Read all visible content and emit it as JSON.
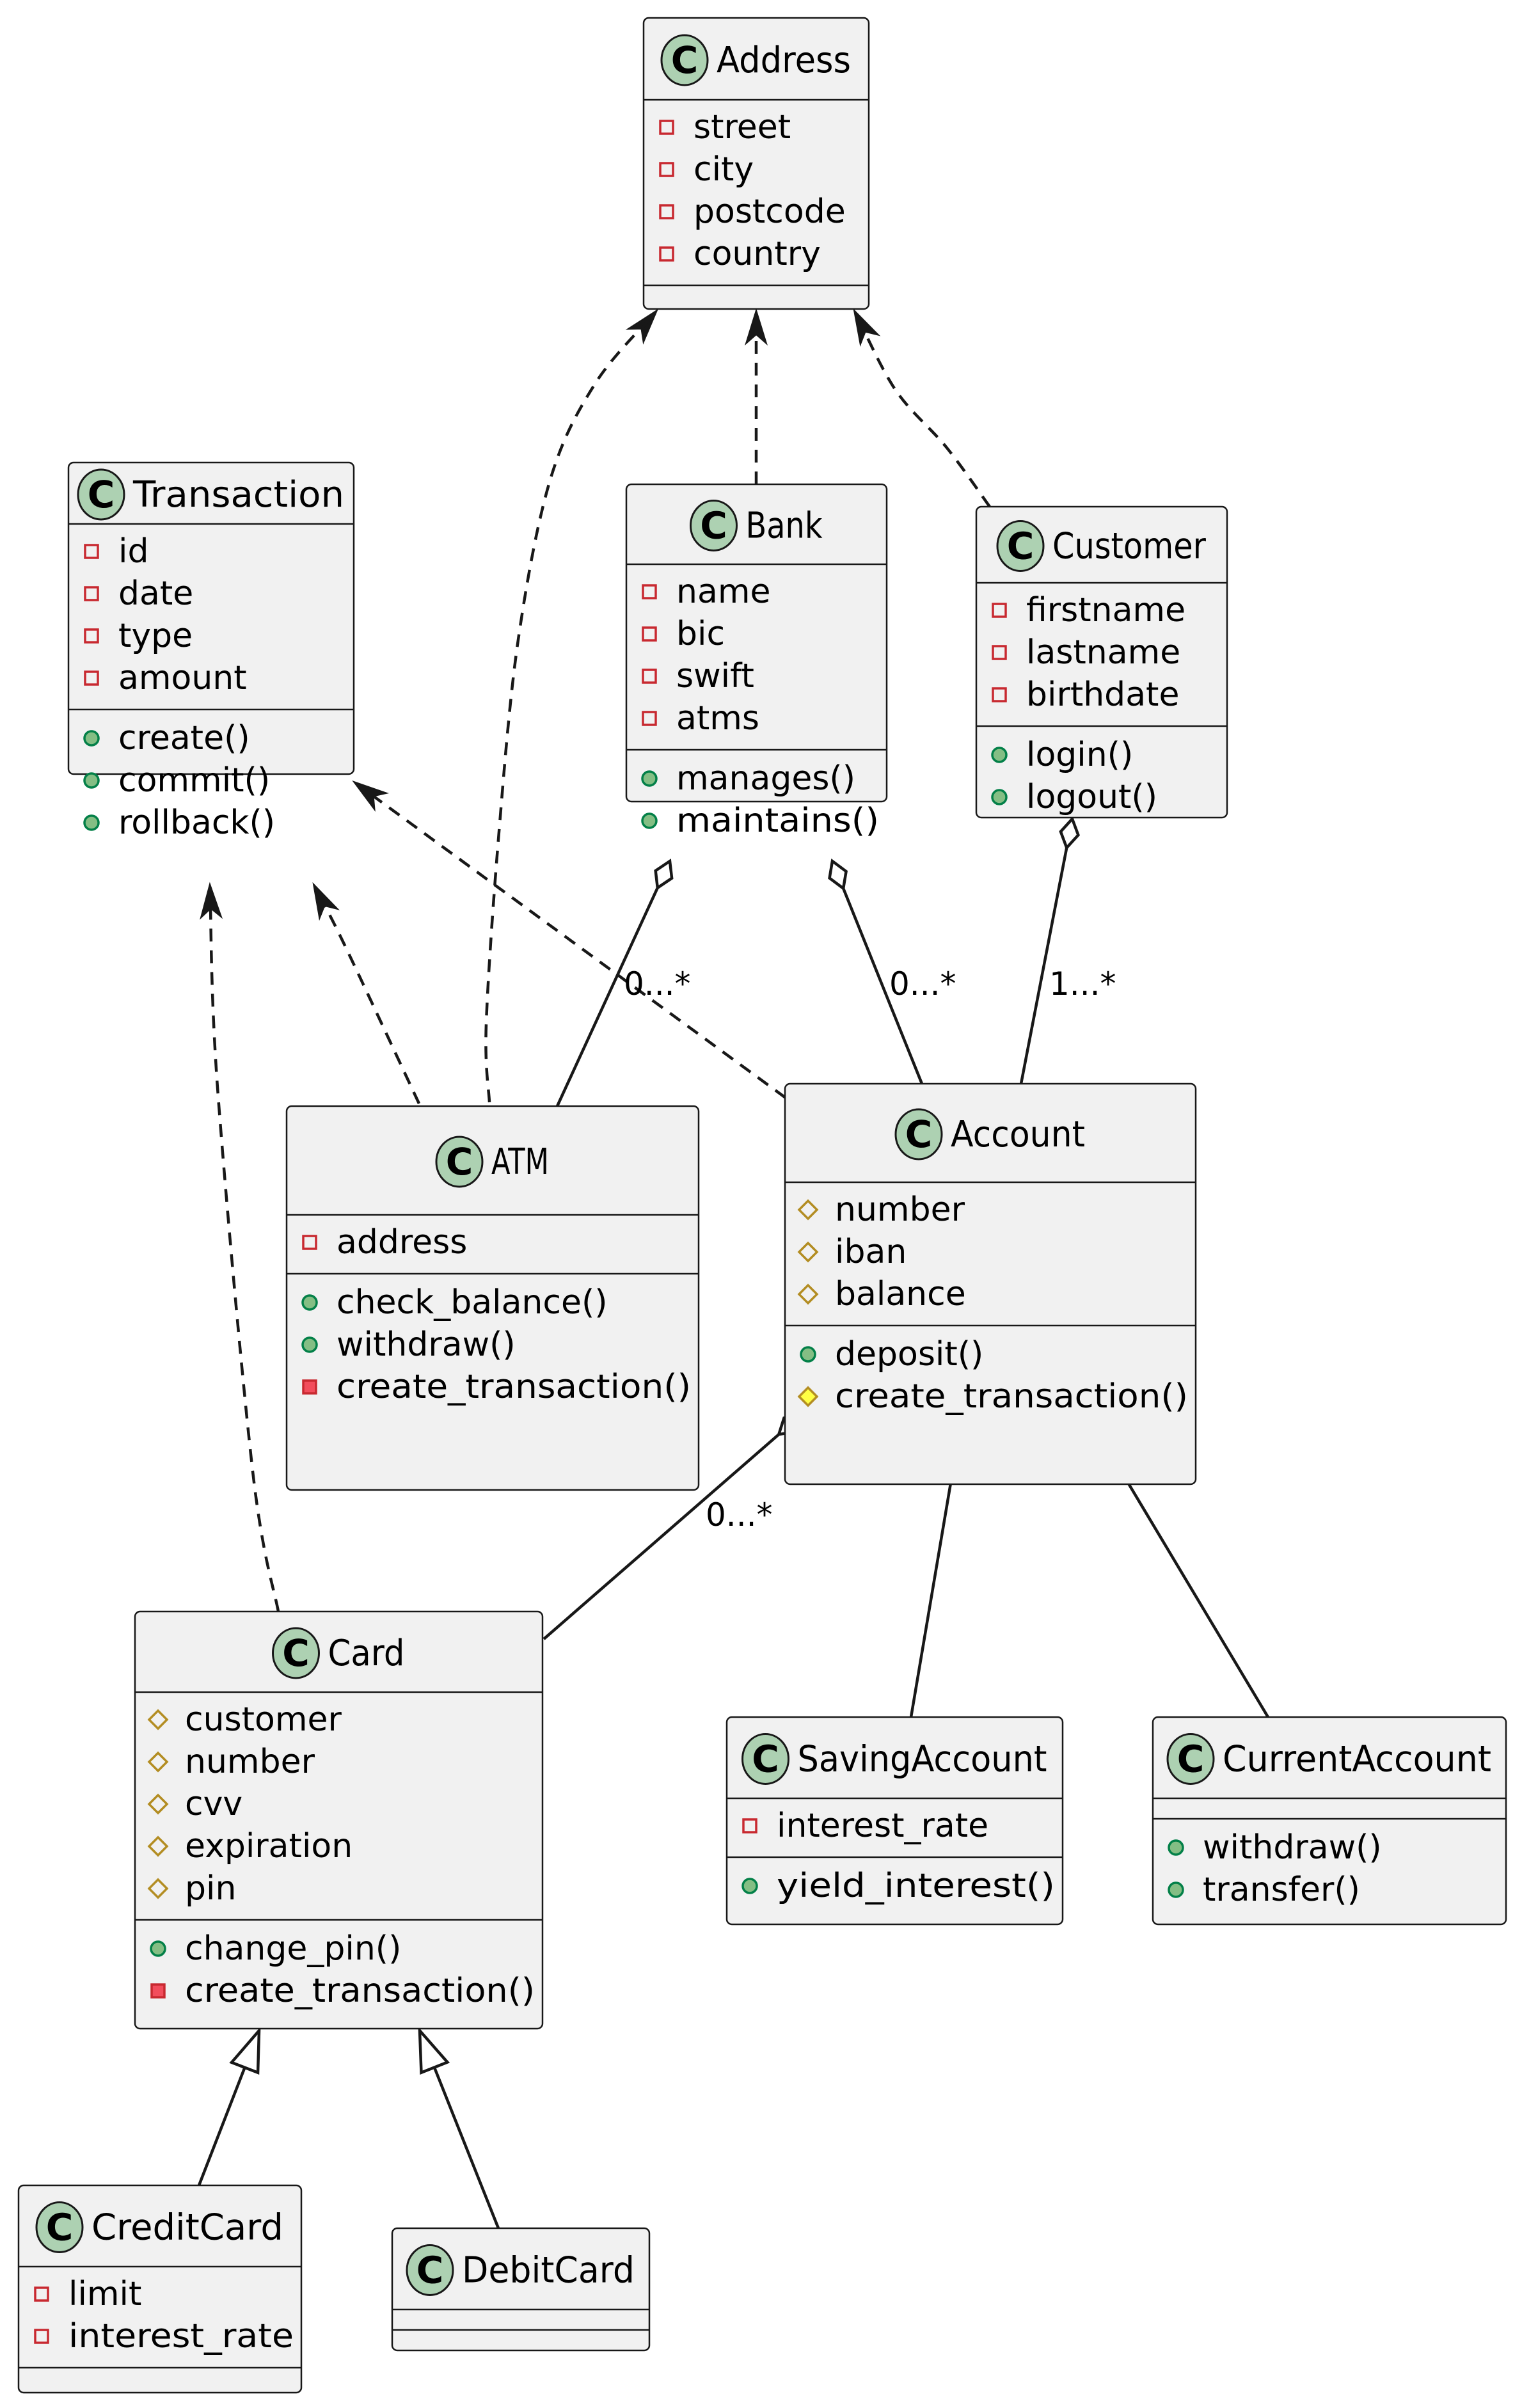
{
  "diagram": {
    "type": "UML class diagram",
    "colors": {
      "class_fill": "#f1f1f1",
      "border": "#181818",
      "class_icon_fill": "#add1b2",
      "private_marker": "#c82930",
      "private_method_fill": "#f24d5c",
      "protected_marker": "#b38d22",
      "protected_method_fill": "#ffff44",
      "public_marker": "#038048",
      "public_fill": "#84be84"
    },
    "classes": [
      {
        "id": "Address",
        "icon": "C",
        "name": "Address",
        "attributes": [
          {
            "vis": "private",
            "name": "street"
          },
          {
            "vis": "private",
            "name": "city"
          },
          {
            "vis": "private",
            "name": "postcode"
          },
          {
            "vis": "private",
            "name": "country"
          }
        ],
        "methods": []
      },
      {
        "id": "Transaction",
        "icon": "C",
        "name": "Transaction",
        "attributes": [
          {
            "vis": "private",
            "name": "id"
          },
          {
            "vis": "private",
            "name": "date"
          },
          {
            "vis": "private",
            "name": "type"
          },
          {
            "vis": "private",
            "name": "amount"
          }
        ],
        "methods": [
          {
            "vis": "public",
            "name": "create()"
          },
          {
            "vis": "public",
            "name": "commit()"
          },
          {
            "vis": "public",
            "name": "rollback()"
          }
        ]
      },
      {
        "id": "Bank",
        "icon": "C",
        "name": "Bank",
        "attributes": [
          {
            "vis": "private",
            "name": "name"
          },
          {
            "vis": "private",
            "name": "bic"
          },
          {
            "vis": "private",
            "name": "swift"
          },
          {
            "vis": "private",
            "name": "atms"
          }
        ],
        "methods": [
          {
            "vis": "public",
            "name": "manages()"
          },
          {
            "vis": "public",
            "name": "maintains()"
          }
        ]
      },
      {
        "id": "Customer",
        "icon": "C",
        "name": "Customer",
        "attributes": [
          {
            "vis": "private",
            "name": "firstname"
          },
          {
            "vis": "private",
            "name": "lastname"
          },
          {
            "vis": "private",
            "name": "birthdate"
          }
        ],
        "methods": [
          {
            "vis": "public",
            "name": "login()"
          },
          {
            "vis": "public",
            "name": "logout()"
          }
        ]
      },
      {
        "id": "ATM",
        "icon": "C",
        "name": "ATM",
        "attributes": [
          {
            "vis": "private",
            "name": "address"
          }
        ],
        "methods": [
          {
            "vis": "public",
            "name": "check_balance()"
          },
          {
            "vis": "public",
            "name": "withdraw()"
          },
          {
            "vis": "private",
            "name": "create_transaction()"
          }
        ]
      },
      {
        "id": "Account",
        "icon": "C",
        "name": "Account",
        "attributes": [
          {
            "vis": "protected",
            "name": "number"
          },
          {
            "vis": "protected",
            "name": "iban"
          },
          {
            "vis": "protected",
            "name": "balance"
          }
        ],
        "methods": [
          {
            "vis": "public",
            "name": "deposit()"
          },
          {
            "vis": "protected",
            "name": "create_transaction()"
          }
        ]
      },
      {
        "id": "Card",
        "icon": "C",
        "name": "Card",
        "attributes": [
          {
            "vis": "protected",
            "name": "customer"
          },
          {
            "vis": "protected",
            "name": "number"
          },
          {
            "vis": "protected",
            "name": "cvv"
          },
          {
            "vis": "protected",
            "name": "expiration"
          },
          {
            "vis": "protected",
            "name": "pin"
          }
        ],
        "methods": [
          {
            "vis": "public",
            "name": "change_pin()"
          },
          {
            "vis": "private",
            "name": "create_transaction()"
          }
        ]
      },
      {
        "id": "SavingAccount",
        "icon": "C",
        "name": "SavingAccount",
        "attributes": [
          {
            "vis": "private",
            "name": "interest_rate"
          }
        ],
        "methods": [
          {
            "vis": "public",
            "name": "yield_interest()"
          }
        ]
      },
      {
        "id": "CurrentAccount",
        "icon": "C",
        "name": "CurrentAccount",
        "attributes": [],
        "methods": [
          {
            "vis": "public",
            "name": "withdraw()"
          },
          {
            "vis": "public",
            "name": "transfer()"
          }
        ]
      },
      {
        "id": "CreditCard",
        "icon": "C",
        "name": "CreditCard",
        "attributes": [
          {
            "vis": "private",
            "name": "limit"
          },
          {
            "vis": "private",
            "name": "interest_rate"
          }
        ],
        "methods": []
      },
      {
        "id": "DebitCard",
        "icon": "C",
        "name": "DebitCard",
        "attributes": [],
        "methods": []
      }
    ],
    "relations": [
      {
        "id": "atm-address",
        "from": "ATM",
        "to": "Address",
        "kind": "dependency",
        "label": ""
      },
      {
        "id": "bank-address",
        "from": "Bank",
        "to": "Address",
        "kind": "dependency",
        "label": ""
      },
      {
        "id": "customer-address",
        "from": "Customer",
        "to": "Address",
        "kind": "dependency",
        "label": ""
      },
      {
        "id": "account-transaction",
        "from": "Account",
        "to": "Transaction",
        "kind": "dependency",
        "label": ""
      },
      {
        "id": "atm-transaction",
        "from": "ATM",
        "to": "Transaction",
        "kind": "dependency",
        "label": ""
      },
      {
        "id": "card-transaction",
        "from": "Card",
        "to": "Transaction",
        "kind": "dependency",
        "label": ""
      },
      {
        "id": "bank-atm",
        "from": "Bank",
        "to": "ATM",
        "kind": "aggregation",
        "label": "0...*"
      },
      {
        "id": "bank-account",
        "from": "Bank",
        "to": "Account",
        "kind": "aggregation",
        "label": "0...*"
      },
      {
        "id": "customer-account",
        "from": "Customer",
        "to": "Account",
        "kind": "aggregation",
        "label": "1...*"
      },
      {
        "id": "account-card",
        "from": "Account",
        "to": "Card",
        "kind": "aggregation",
        "label": "0...*"
      },
      {
        "id": "savingaccount-account",
        "from": "SavingAccount",
        "to": "Account",
        "kind": "inheritance",
        "label": ""
      },
      {
        "id": "currentaccount-account",
        "from": "CurrentAccount",
        "to": "Account",
        "kind": "inheritance",
        "label": ""
      },
      {
        "id": "creditcard-card",
        "from": "CreditCard",
        "to": "Card",
        "kind": "inheritance",
        "label": ""
      },
      {
        "id": "debitcard-card",
        "from": "DebitCard",
        "to": "Card",
        "kind": "inheritance",
        "label": ""
      }
    ]
  }
}
